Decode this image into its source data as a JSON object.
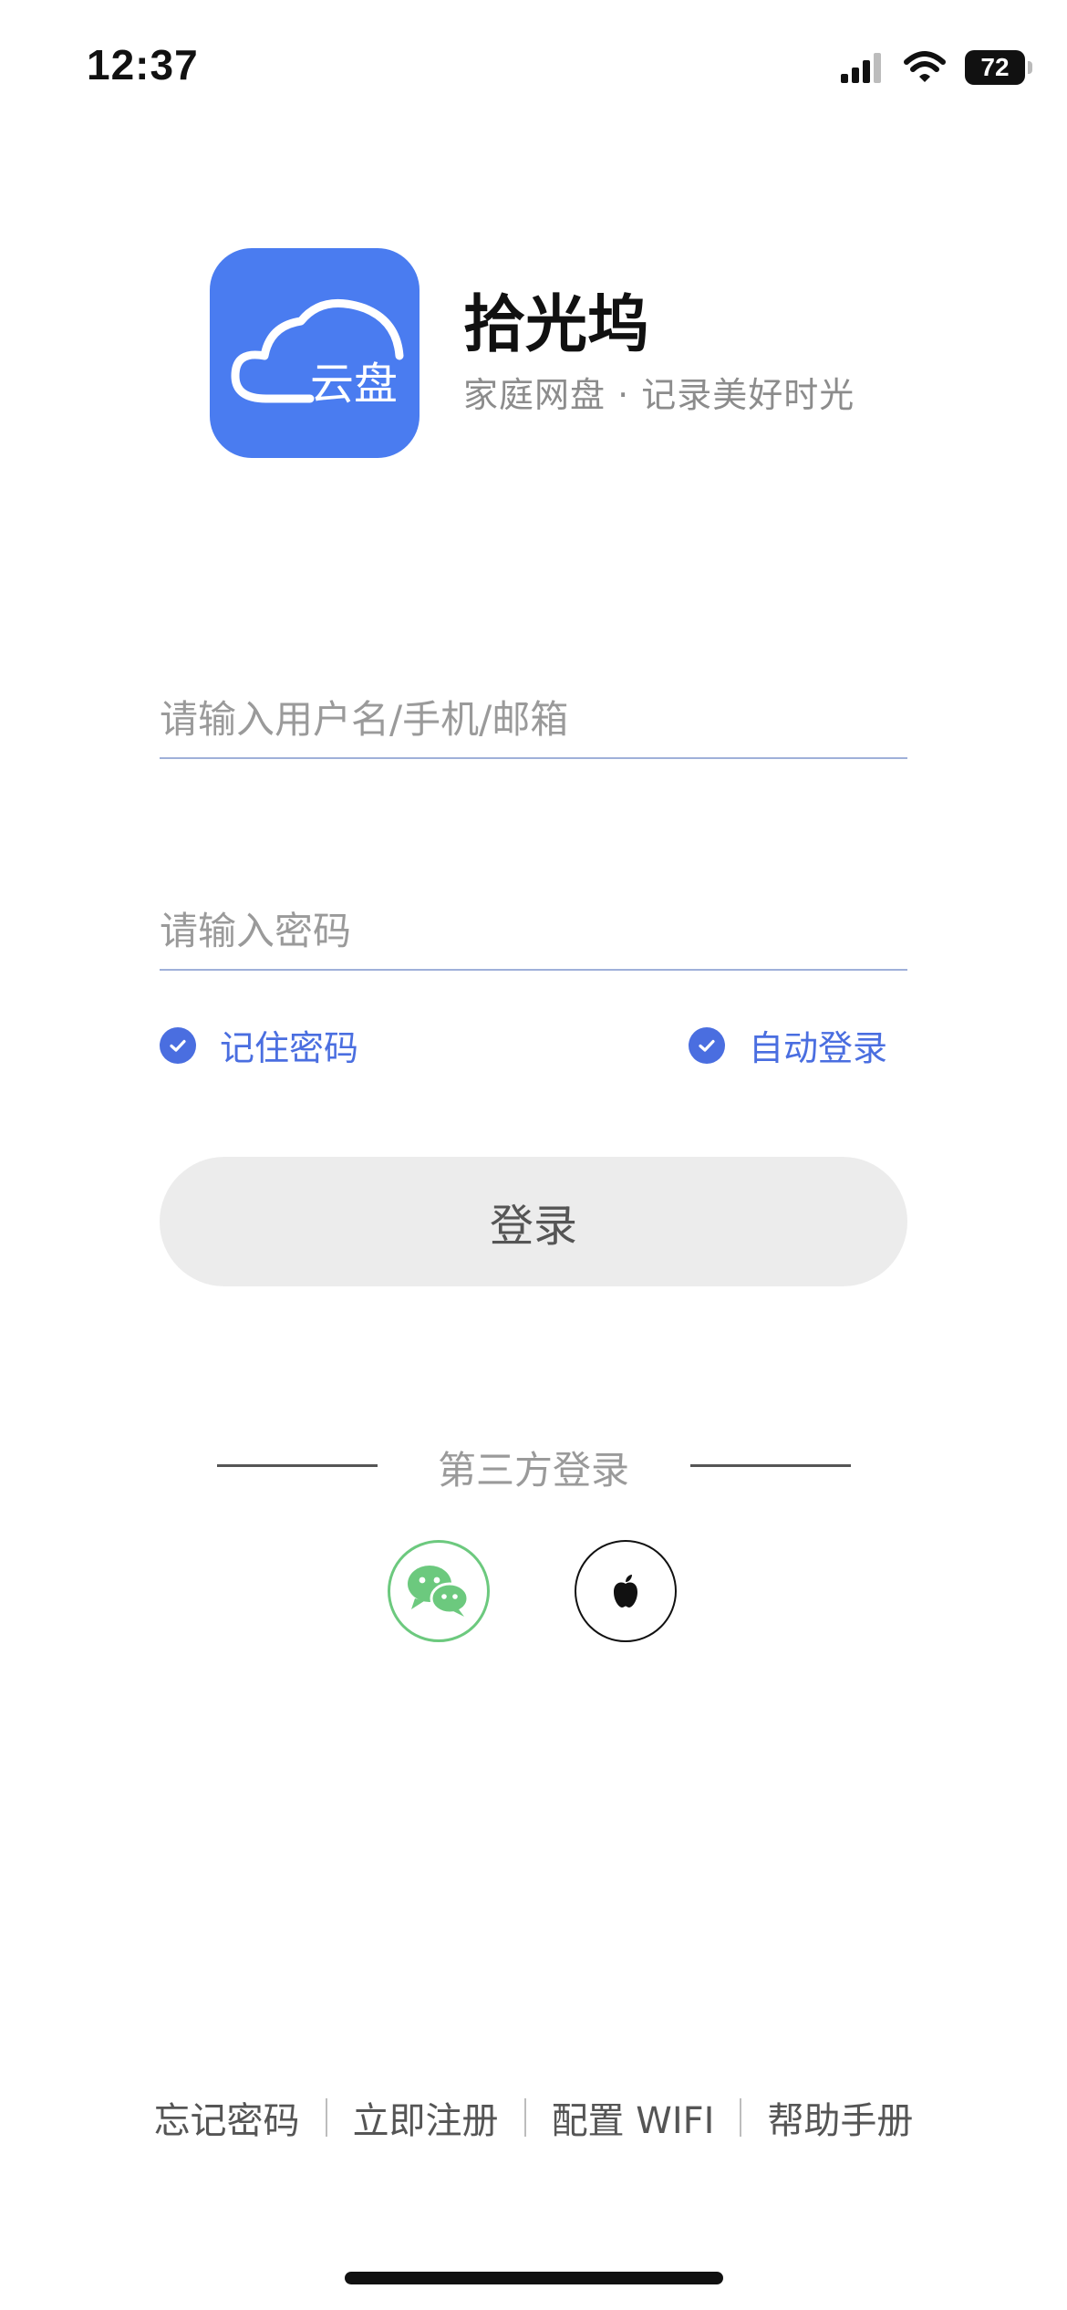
{
  "status_bar": {
    "time": "12:37",
    "battery": "72"
  },
  "app": {
    "name": "拾光坞",
    "slogan": "家庭网盘 · 记录美好时光",
    "logo_text": "云盘",
    "brand_color": "#4a7cf0"
  },
  "form": {
    "username_placeholder": "请输入用户名/手机/邮箱",
    "password_placeholder": "请输入密码",
    "remember_label": "记住密码",
    "auto_login_label": "自动登录",
    "login_label": "登录",
    "accent_color": "#4a6ee0"
  },
  "third_party": {
    "title": "第三方登录",
    "providers": [
      "wechat",
      "apple"
    ]
  },
  "footer": {
    "forgot": "忘记密码",
    "register": "立即注册",
    "wifi": "配置 WIFI",
    "help": "帮助手册"
  }
}
